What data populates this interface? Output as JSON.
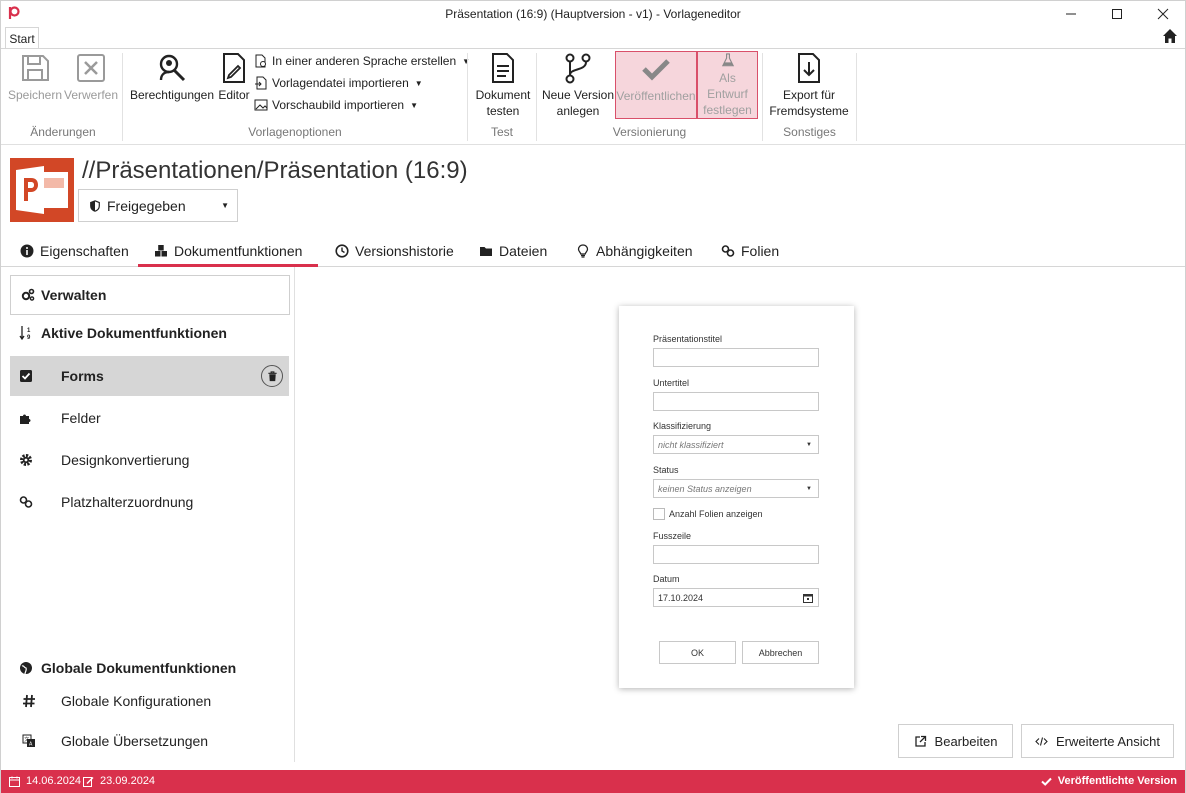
{
  "window": {
    "title": "Präsentation (16:9) (Hauptversion - v1) - Vorlageneditor"
  },
  "ribbon": {
    "tab_start": "Start",
    "buttons": {
      "save": "Speichern",
      "discard": "Verwerfen",
      "permissions": "Berechtigungen",
      "editor": "Editor",
      "create_language": "In einer anderen Sprache erstellen",
      "import_template": "Vorlagendatei importieren",
      "import_preview": "Vorschaubild importieren",
      "test_doc_line1": "Dokument",
      "test_doc_line2": "testen",
      "new_version_line1": "Neue Version",
      "new_version_line2": "anlegen",
      "publish": "Veröffentlichen",
      "draft_line1": "Als Entwurf",
      "draft_line2": "festlegen",
      "export_line1": "Export für",
      "export_line2": "Fremdsysteme"
    },
    "groups": {
      "changes": "Änderungen",
      "template_options": "Vorlagenoptionen",
      "test": "Test",
      "versioning": "Versionierung",
      "misc": "Sonstiges"
    }
  },
  "header": {
    "path": "//Präsentationen/Präsentation (16:9)",
    "status_value": "Freigegeben"
  },
  "tabs": [
    {
      "label": "Eigenschaften"
    },
    {
      "label": "Dokumentfunktionen"
    },
    {
      "label": "Versionshistorie"
    },
    {
      "label": "Dateien"
    },
    {
      "label": "Abhängigkeiten"
    },
    {
      "label": "Folien"
    }
  ],
  "sidebar": {
    "manage": "Verwalten",
    "active_heading": "Aktive Dokumentfunktionen",
    "active_items": [
      {
        "label": "Forms"
      },
      {
        "label": "Felder"
      },
      {
        "label": "Designkonvertierung"
      },
      {
        "label": "Platzhalterzuordnung"
      }
    ],
    "global_heading": "Globale Dokumentfunktionen",
    "global_items": [
      {
        "label": "Globale Konfigurationen"
      },
      {
        "label": "Globale Übersetzungen"
      }
    ]
  },
  "form_preview": {
    "title_label": "Präsentationstitel",
    "subtitle_label": "Untertitel",
    "classification_label": "Klassifizierung",
    "classification_value": "nicht klassifiziert",
    "status_label": "Status",
    "status_value": "keinen Status anzeigen",
    "show_slide_count": "Anzahl Folien anzeigen",
    "footer_label": "Fusszeile",
    "date_label": "Datum",
    "date_value": "17.10.2024",
    "ok": "OK",
    "cancel": "Abbrechen"
  },
  "actions": {
    "edit": "Bearbeiten",
    "advanced_view": "Erweiterte Ansicht"
  },
  "statusbar": {
    "created": "14.06.2024",
    "modified": "23.09.2024",
    "state": "Veröffentlichte Version"
  },
  "colors": {
    "accent": "#d9304c",
    "highlight_bg": "#f6d6dc",
    "ppt_orange": "#d24726"
  }
}
